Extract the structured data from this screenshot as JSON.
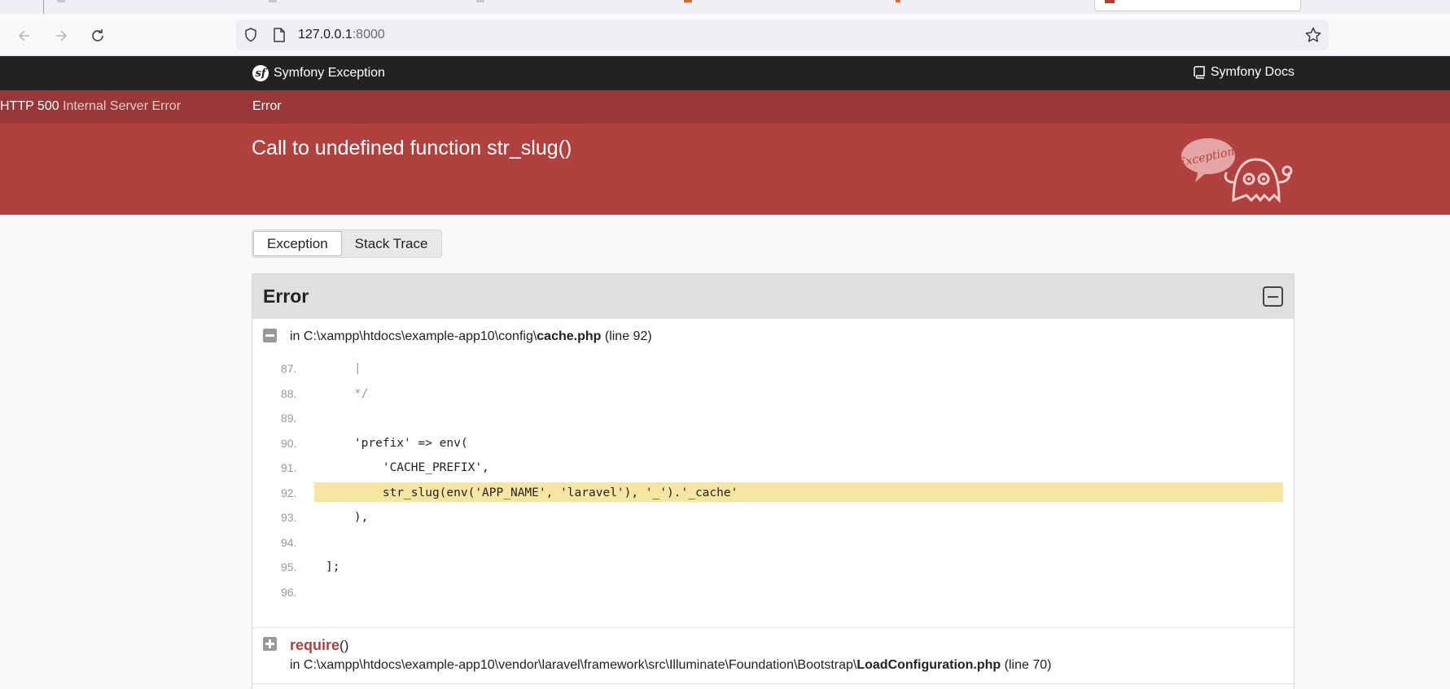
{
  "browser": {
    "url_host": "127.0.0.1",
    "url_port": ":8000"
  },
  "header": {
    "brand": "Symfony Exception",
    "docs": "Symfony Docs"
  },
  "status": {
    "kind": "Error",
    "code": "HTTP 500",
    "phrase": "Internal Server Error"
  },
  "message": "Call to undefined function str_slug()",
  "ghost_text": "Exception!",
  "tabs": {
    "exception": "Exception",
    "stack_trace": "Stack Trace"
  },
  "panel": {
    "title": "Error",
    "first_frame": {
      "prefix": "in C:\\xampp\\htdocs\\example-app10\\config\\",
      "file": "cache.php",
      "suffix": " (line 92)"
    },
    "code_lines": [
      {
        "n": "87.",
        "t": "    |"
      },
      {
        "n": "88.",
        "t": "    */"
      },
      {
        "n": "89.",
        "t": ""
      },
      {
        "n": "90.",
        "t": "    'prefix' => env("
      },
      {
        "n": "91.",
        "t": "        'CACHE_PREFIX',"
      },
      {
        "n": "92.",
        "t": "        str_slug(env('APP_NAME', 'laravel'), '_').'_cache'"
      },
      {
        "n": "93.",
        "t": "    ),"
      },
      {
        "n": "94.",
        "t": ""
      },
      {
        "n": "95.",
        "t": "];"
      },
      {
        "n": "96.",
        "t": ""
      }
    ],
    "second_frame": {
      "function": "require",
      "args": "()",
      "prefix": "in C:\\xampp\\htdocs\\example-app10\\vendor\\laravel\\framework\\src\\Illuminate\\Foundation\\Bootstrap\\",
      "file": "LoadConfiguration.php",
      "suffix": " (line 70)"
    }
  }
}
